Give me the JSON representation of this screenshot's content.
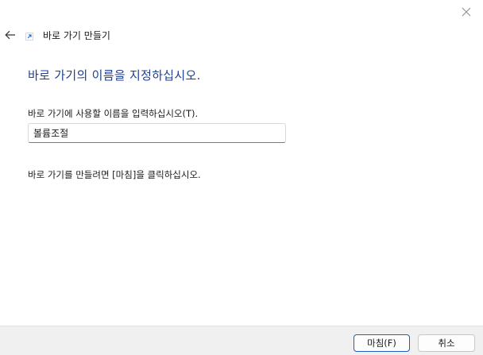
{
  "window": {
    "title": "바로 가기 만들기",
    "close_icon": "close-icon",
    "back_icon": "back-arrow-icon",
    "wizard_icon": "shortcut-icon"
  },
  "main": {
    "heading": "바로 가기의 이름을 지정하십시오.",
    "field_label": "바로 가기에 사용할 이름을 입력하십시오(T).",
    "name_value": "볼륨조절",
    "finish_hint": "바로 가기를 만들려면 [마침]을 클릭하십시오."
  },
  "footer": {
    "finish_label": "마침(F)",
    "cancel_label": "취소"
  },
  "colors": {
    "heading": "#1f3f8f",
    "primary_border": "#1f5fbf",
    "footer_bg": "#f0f0f0"
  }
}
